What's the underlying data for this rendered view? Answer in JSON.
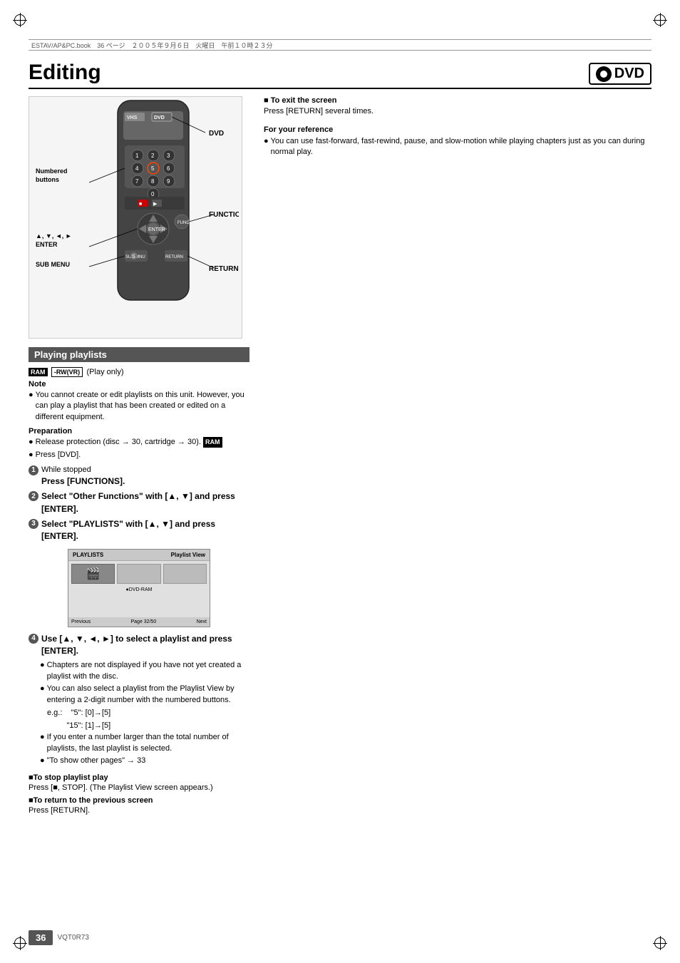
{
  "header": {
    "bar_text": "ESTAV/AP&PC.book　36 ページ　２００５年９月６日　火曜日　午前１０時２３分"
  },
  "title": {
    "text": "Editing",
    "dvd_label": "DVD"
  },
  "remote": {
    "labels": {
      "numbered_buttons": "Numbered\nbuttons",
      "dvd": "DVD",
      "functions": "FUNCTIONS",
      "enter_arrows": "▲, ▼, ◄, ►\nENTER",
      "sub_menu": "SUB MENU",
      "return": "RETURN"
    }
  },
  "playing_playlists": {
    "section_title": "Playing playlists",
    "disc_badges": [
      "RAM",
      "-RW(VR)"
    ],
    "play_only": "(Play only)",
    "note_label": "Note",
    "notes": [
      "You cannot create or edit playlists on this unit. However, you can play a playlist that has been created or edited on a different equipment."
    ],
    "prep_label": "Preparation",
    "prep_items": [
      "Release protection (disc → 30, cartridge → 30).  RAM",
      "Press [DVD]."
    ],
    "steps": [
      {
        "num": "1",
        "sub": "While stopped",
        "main": "Press [FUNCTIONS]."
      },
      {
        "num": "2",
        "main": "Select \"Other Functions\" with [▲, ▼] and press [ENTER]."
      },
      {
        "num": "3",
        "main": "Select \"PLAYLISTS\" with [▲, ▼] and press [ENTER]."
      },
      {
        "num": "4",
        "main": "Use [▲, ▼, ◄, ►] to select a playlist and press [ENTER]."
      }
    ],
    "step4_bullets": [
      "Chapters are not displayed if you have not yet created a playlist with the disc.",
      "You can also select a playlist from the Playlist View by entering a 2-digit number with the numbered buttons.",
      "e.g.:    \"5\":  [0]→[5]",
      "         \"15\": [1]→[5]",
      "If you enter a number larger than the total number of playlists, the last playlist is selected.",
      "\"To show other pages\" → 33"
    ],
    "to_stop_header": "■To stop playlist play",
    "to_stop_text": "Press [■, STOP]. (The Playlist View screen appears.)",
    "to_return_header": "■To return to the previous screen",
    "to_return_text": "Press [RETURN]."
  },
  "right_col": {
    "to_exit_header": "■To exit the screen",
    "to_exit_text": "Press [RETURN] several times.",
    "for_ref_header": "For your reference",
    "for_ref_bullets": [
      "You can use fast-forward, fast-rewind, pause, and slow-motion while playing chapters just as you can during normal play."
    ]
  },
  "playlist_screen": {
    "header_left": "PLAYLISTS",
    "header_right": "Playlist View",
    "disc_label": "DVD-RAM",
    "footer_items": [
      "Previous",
      "Page 32/50",
      "Next"
    ]
  },
  "footer": {
    "page_number": "36",
    "code": "VQT0R73"
  }
}
